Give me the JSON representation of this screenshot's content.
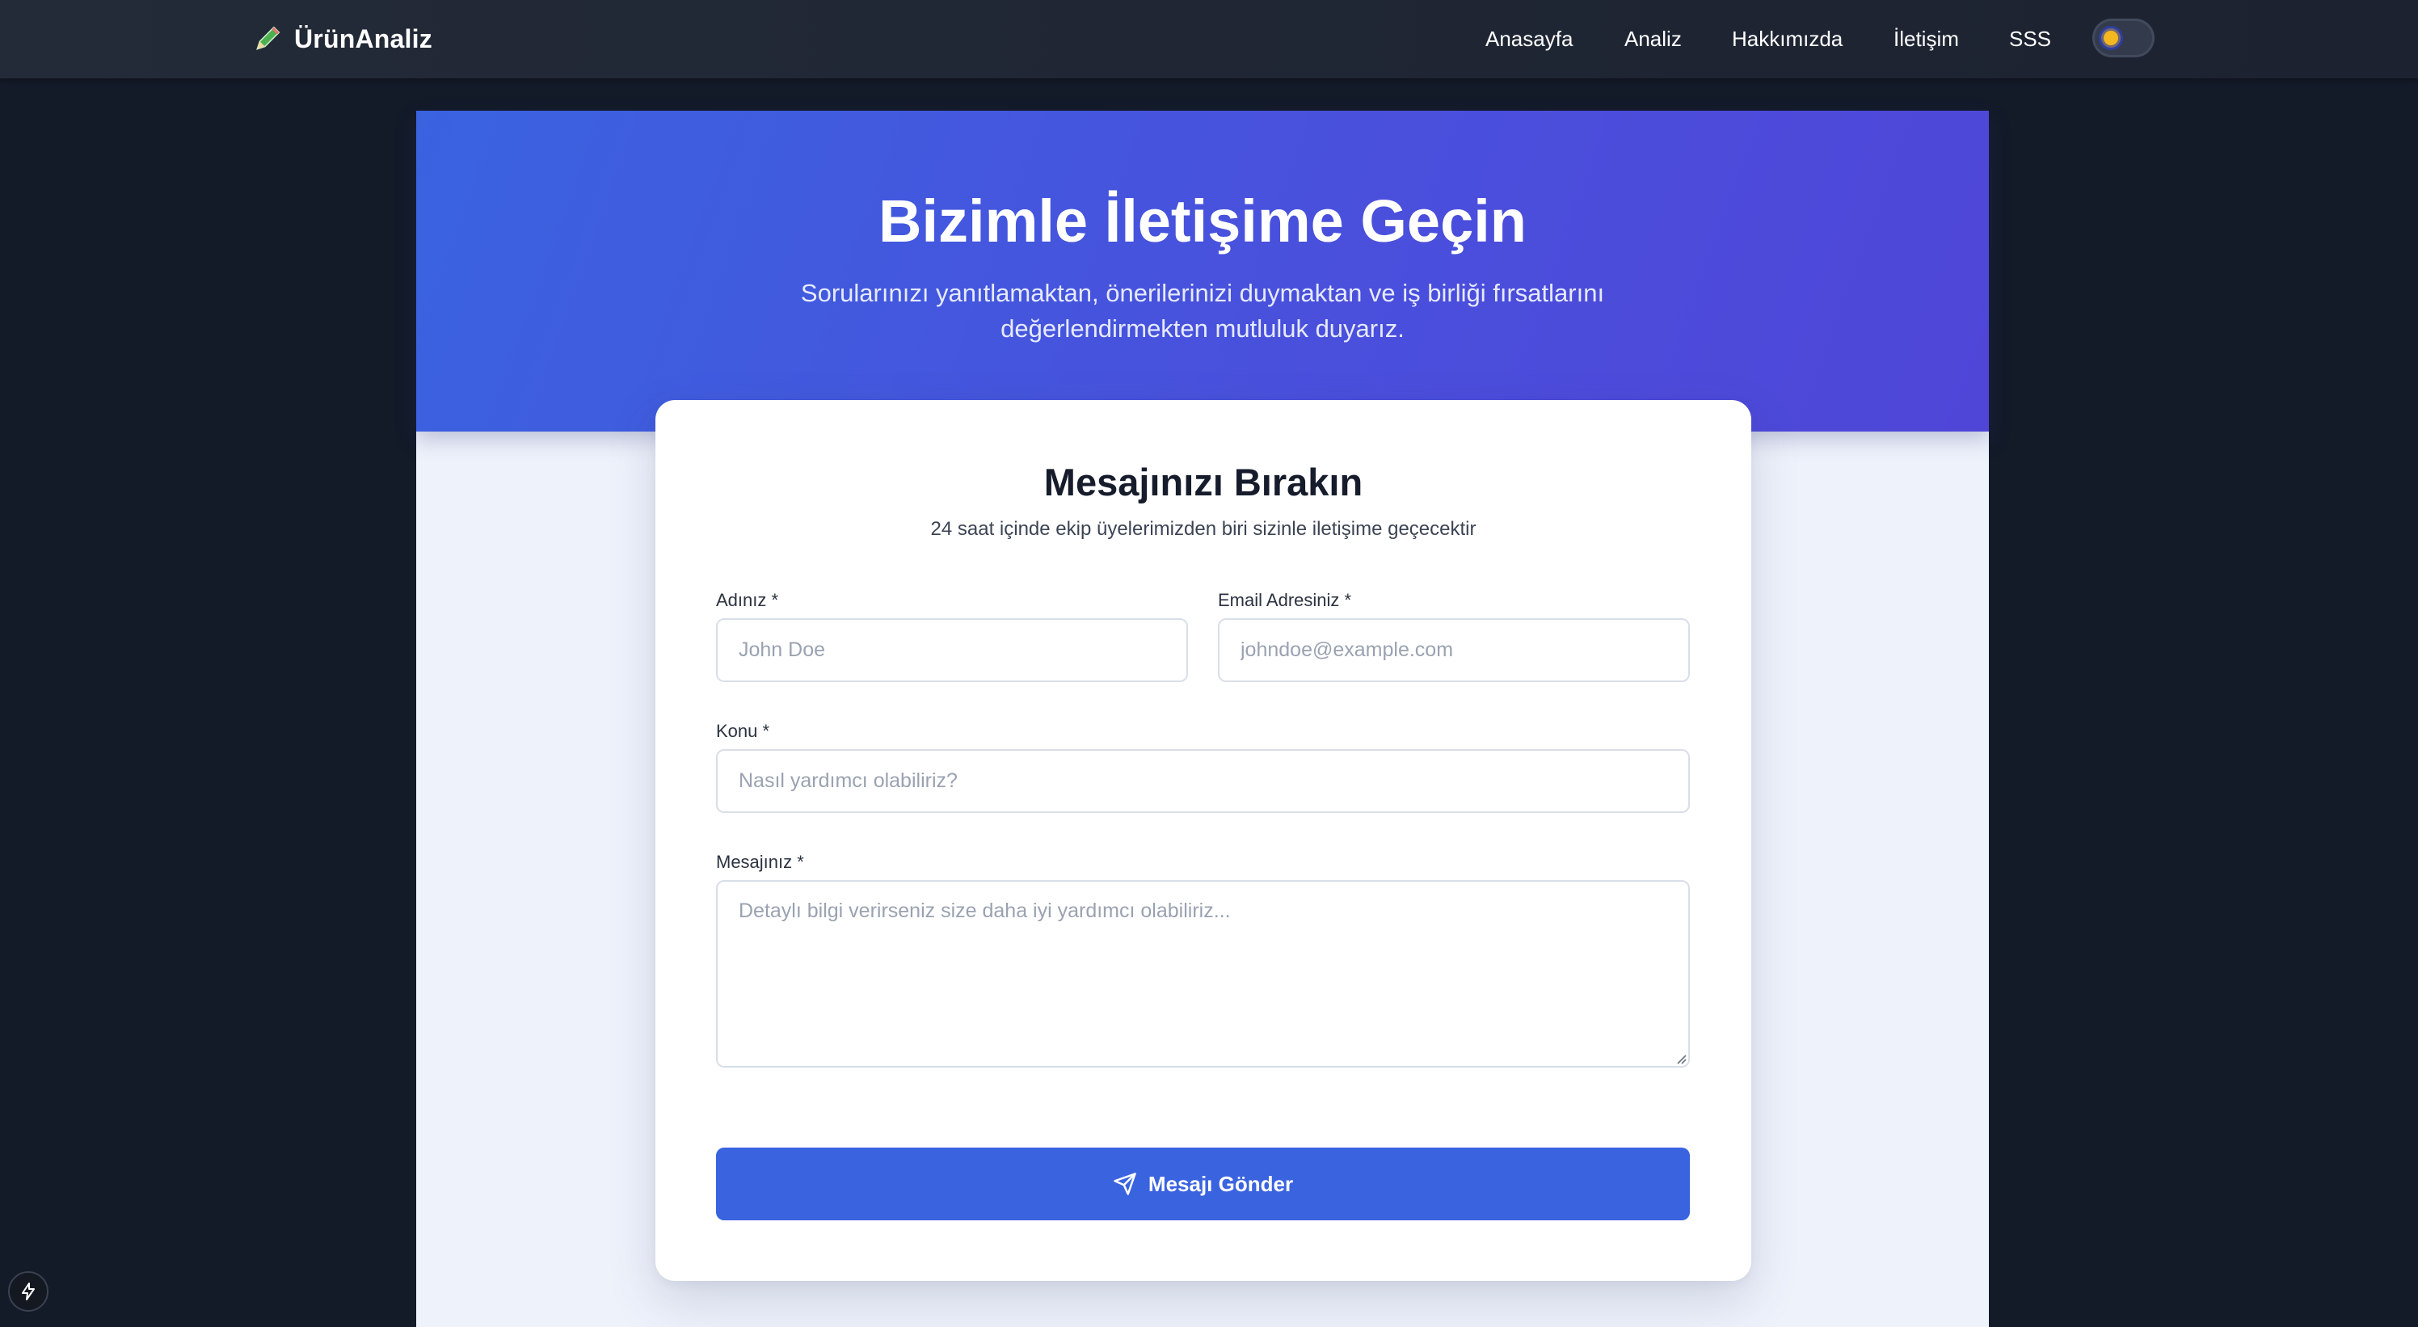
{
  "navbar": {
    "brand": "ÜrünAnaliz",
    "brand_icon": "pencil-icon",
    "links": [
      {
        "label": "Anasayfa"
      },
      {
        "label": "Analiz"
      },
      {
        "label": "Hakkımızda"
      },
      {
        "label": "İletişim"
      },
      {
        "label": "SSS"
      }
    ],
    "theme_toggle_icon": "sun-icon"
  },
  "hero": {
    "title": "Bizimle İletişime Geçin",
    "subtitle": "Sorularınızı yanıtlamaktan, önerilerinizi duymaktan ve iş birliği fırsatlarını değerlendirmekten mutluluk duyarız."
  },
  "form": {
    "title": "Mesajınızı Bırakın",
    "subtitle": "24 saat içinde ekip üyelerimizden biri sizinle iletişime geçecektir",
    "name": {
      "label": "Adınız *",
      "placeholder": "John Doe",
      "value": ""
    },
    "email": {
      "label": "Email Adresiniz *",
      "placeholder": "johndoe@example.com",
      "value": ""
    },
    "subject": {
      "label": "Konu *",
      "placeholder": "Nasıl yardımcı olabiliriz?",
      "value": ""
    },
    "message": {
      "label": "Mesajınız *",
      "placeholder": "Detaylı bilgi verirseniz size daha iyi yardımcı olabiliriz...",
      "value": ""
    },
    "submit_label": "Mesajı Gönder",
    "submit_icon": "send-icon"
  },
  "colors": {
    "accent": "#3a63e0",
    "hero_gradient_end": "#4f46d8",
    "page_background": "#131a28",
    "navbar_background": "#1f2533"
  },
  "corner_badge_icon": "lightning-icon"
}
